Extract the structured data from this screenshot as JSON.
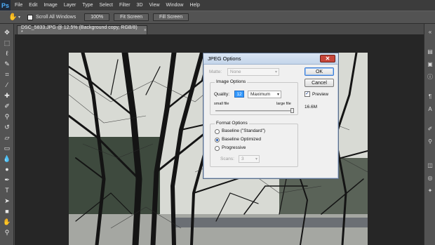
{
  "app": {
    "logo": "Ps"
  },
  "menu": [
    "File",
    "Edit",
    "Image",
    "Layer",
    "Type",
    "Select",
    "Filter",
    "3D",
    "View",
    "Window",
    "Help"
  ],
  "options_bar": {
    "scroll_all_windows": "Scroll All Windows",
    "zoom_100": "100%",
    "fit_screen": "Fit Screen",
    "fill_screen": "Fill Screen"
  },
  "document": {
    "tab_title": "DSC_5833.JPG @ 12.5% (Background copy, RGB/8) *",
    "tab_close": "×"
  },
  "dialog": {
    "title": "JPEG Options",
    "matte_label": "Matte:",
    "matte_value": "None",
    "image_options_title": "Image Options",
    "quality_label": "Quality:",
    "quality_value": "12",
    "quality_preset": "Maximum",
    "small_file": "small file",
    "large_file": "large file",
    "quality_slider_fraction": 1.0,
    "format_options_title": "Format Options",
    "format_options": [
      "Baseline (\"Standard\")",
      "Baseline Optimized",
      "Progressive"
    ],
    "format_selected": "Baseline Optimized",
    "scans_label": "Scans:",
    "scans_value": "3",
    "ok": "OK",
    "cancel": "Cancel",
    "preview_label": "Preview",
    "preview_checked": true,
    "file_size": "16.6M"
  },
  "colors": {
    "accent_blue": "#3399ff",
    "dialog_close": "#c7463a",
    "app_background": "#4a4a4a"
  }
}
